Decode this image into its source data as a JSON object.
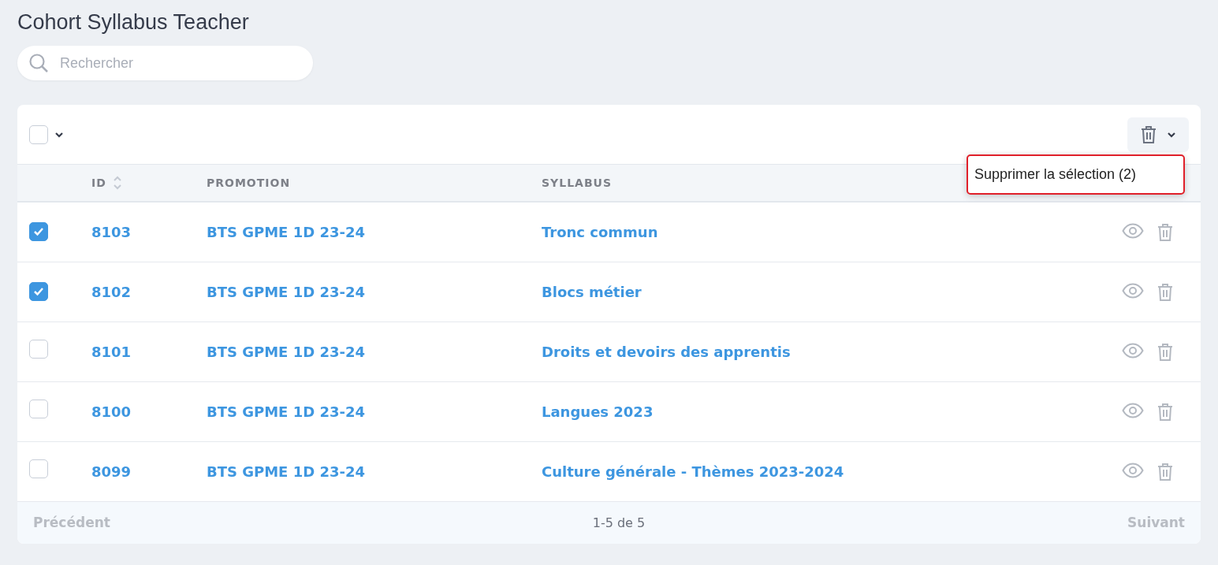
{
  "page": {
    "title": "Cohort Syllabus Teacher"
  },
  "search": {
    "placeholder": "Rechercher"
  },
  "select_all": {
    "checked": false
  },
  "bulk_menu": {
    "open": true,
    "items": [
      {
        "label": "Supprimer la sélection (2)",
        "highlighted": true
      }
    ]
  },
  "table": {
    "columns": [
      {
        "label": "ID",
        "sortable": true
      },
      {
        "label": "PROMOTION",
        "sortable": false
      },
      {
        "label": "SYLLABUS",
        "sortable": false
      }
    ],
    "rows": [
      {
        "checked": true,
        "id": "8103",
        "promotion": "BTS GPME 1D 23-24",
        "syllabus": "Tronc commun"
      },
      {
        "checked": true,
        "id": "8102",
        "promotion": "BTS GPME 1D 23-24",
        "syllabus": "Blocs métier"
      },
      {
        "checked": false,
        "id": "8101",
        "promotion": "BTS GPME 1D 23-24",
        "syllabus": "Droits et devoirs des apprentis"
      },
      {
        "checked": false,
        "id": "8100",
        "promotion": "BTS GPME 1D 23-24",
        "syllabus": "Langues 2023"
      },
      {
        "checked": false,
        "id": "8099",
        "promotion": "BTS GPME 1D 23-24",
        "syllabus": "Culture générale - Thèmes 2023-2024"
      }
    ]
  },
  "pagination": {
    "previous": {
      "label": "Précédent",
      "disabled": true
    },
    "range": "1-5 de 5",
    "next": {
      "label": "Suivant",
      "disabled": true
    }
  }
}
